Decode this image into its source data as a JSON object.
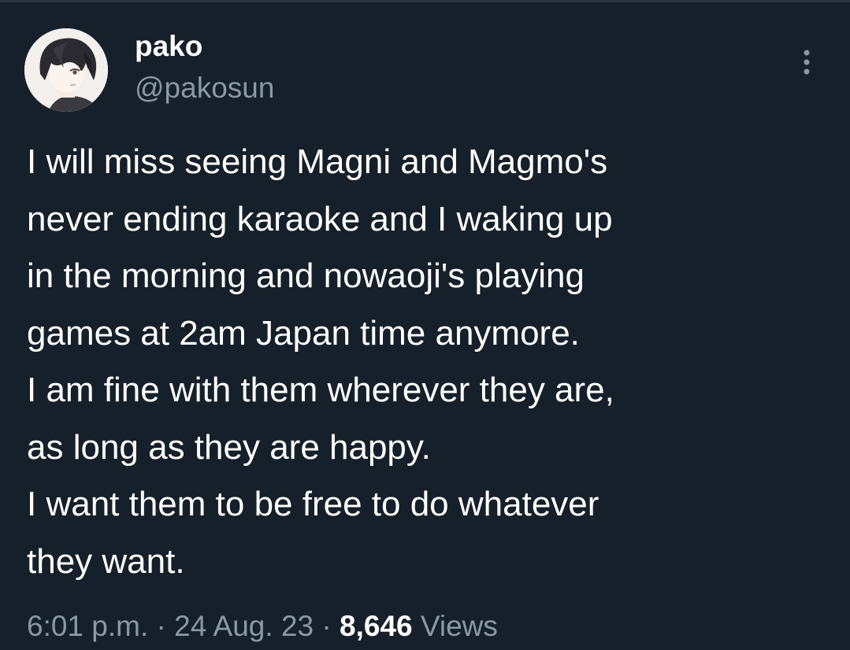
{
  "tweet": {
    "author": {
      "display_name": "pako",
      "handle": "@pakosun",
      "avatar_icon": "anime-avatar-icon"
    },
    "more_icon": "more-vertical-icon",
    "text_lines": [
      "I will miss seeing Magni and Magmo's",
      "never ending karaoke and I waking up",
      "in the morning and nowaoji's playing",
      "games at 2am Japan time anymore.",
      "I am fine with them wherever they are,",
      "as long as they are happy.",
      "I want them to be free to do whatever",
      "they want."
    ],
    "meta": {
      "time": "6:01 p.m.",
      "separator": " · ",
      "date": "24 Aug. 23",
      "views_count": "8,646",
      "views_label": "Views"
    }
  },
  "colors": {
    "background": "#15202b",
    "primary_text": "#ffffff",
    "secondary_text": "#8b98a5"
  }
}
